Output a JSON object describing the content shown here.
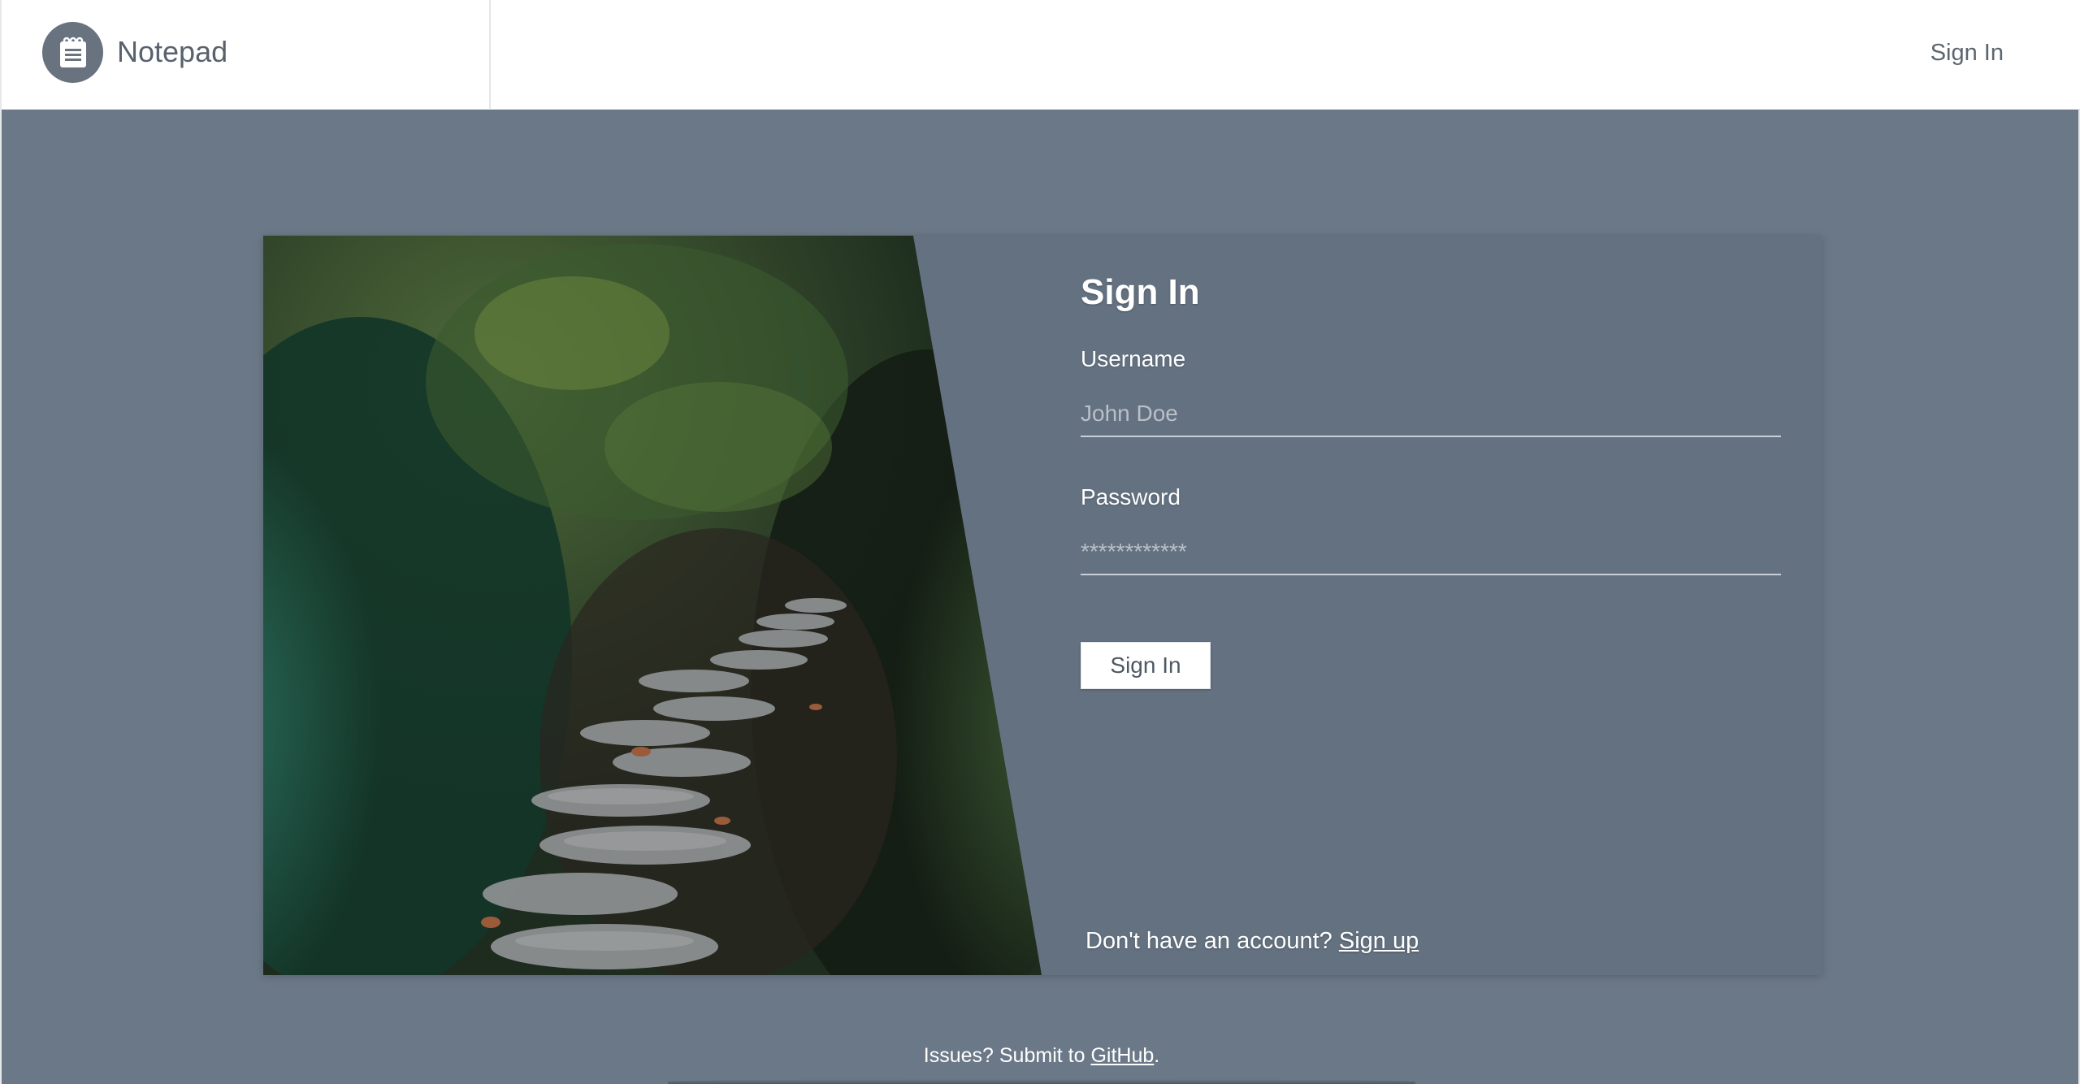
{
  "app": {
    "name": "Notepad",
    "logo_icon": "notepad-icon"
  },
  "nav": {
    "sign_in_label": "Sign In"
  },
  "form": {
    "title": "Sign In",
    "username_label": "Username",
    "username_placeholder": "John Doe",
    "password_label": "Password",
    "password_placeholder": "************",
    "submit_label": "Sign In",
    "no_account_text": "Don't have an account?",
    "signup_link": "Sign up"
  },
  "footer": {
    "prefix": "Issues? Submit to",
    "link": "GitHub",
    "suffix": "."
  },
  "colors": {
    "background": "#6b7887",
    "card": "#647180",
    "topbar": "#ffffff",
    "logo": "#68737f"
  }
}
